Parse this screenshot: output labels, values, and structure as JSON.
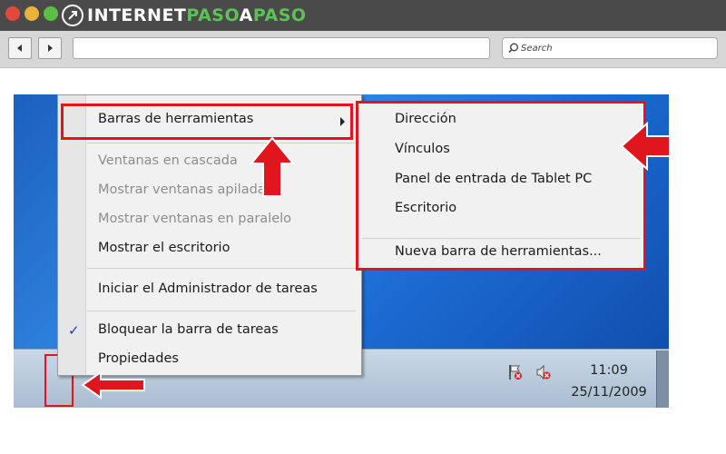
{
  "browser": {
    "logo_internet": "INTERNET",
    "logo_paso": "PASO",
    "logo_a": "A",
    "logo_paso2": "PASO",
    "search_placeholder": "Search"
  },
  "context_menu": {
    "toolbars": "Barras de herramientas",
    "cascade": "Ventanas en cascada",
    "stacked": "Mostrar ventanas apiladas",
    "side_by_side": "Mostrar ventanas en paralelo",
    "show_desktop": "Mostrar el escritorio",
    "task_manager": "Iniciar el Administrador de tareas",
    "lock_taskbar": "Bloquear la barra de tareas",
    "properties": "Propiedades"
  },
  "submenu": {
    "address": "Dirección",
    "links": "Vínculos",
    "tablet": "Panel de entrada de Tablet PC",
    "desktop": "Escritorio",
    "new_toolbar": "Nueva barra de herramientas..."
  },
  "taskbar": {
    "time": "11:09",
    "date": "25/11/2009"
  },
  "colors": {
    "highlight": "#e0151d",
    "logo_green": "#5dc256",
    "desktop_blue": "#2f86e0"
  }
}
